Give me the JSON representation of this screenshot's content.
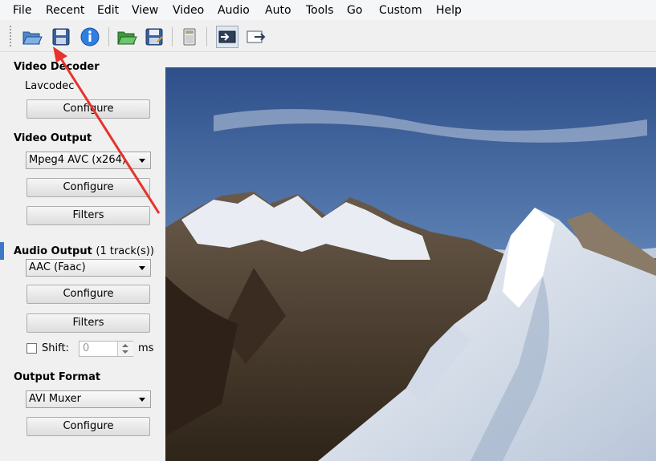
{
  "menu": [
    "File",
    "Recent",
    "Edit",
    "View",
    "Video",
    "Audio",
    "Auto",
    "Tools",
    "Go",
    "Custom",
    "Help"
  ],
  "toolbar": {
    "icons": [
      "open-folder-icon",
      "save-disk-icon",
      "info-icon",
      "open-green-folder-icon",
      "save-as-icon",
      "calculator-icon",
      "play-input-icon",
      "play-output-icon"
    ]
  },
  "video_decoder": {
    "title": "Video Decoder",
    "codec": "Lavcodec",
    "configure_label": "Configure"
  },
  "video_output": {
    "title": "Video Output",
    "selected": "Mpeg4 AVC (x264)",
    "configure_label": "Configure",
    "filters_label": "Filters"
  },
  "audio_output": {
    "title": "Audio Output",
    "tracks": "(1 track(s))",
    "selected": "AAC (Faac)",
    "configure_label": "Configure",
    "filters_label": "Filters",
    "shift_label": "Shift:",
    "shift_value": "0",
    "shift_unit": "ms"
  },
  "output_format": {
    "title": "Output Format",
    "selected": "AVI Muxer",
    "configure_label": "Configure"
  },
  "colors": {
    "annotation_arrow": "#e8322a",
    "accent": "#3c78c8"
  }
}
